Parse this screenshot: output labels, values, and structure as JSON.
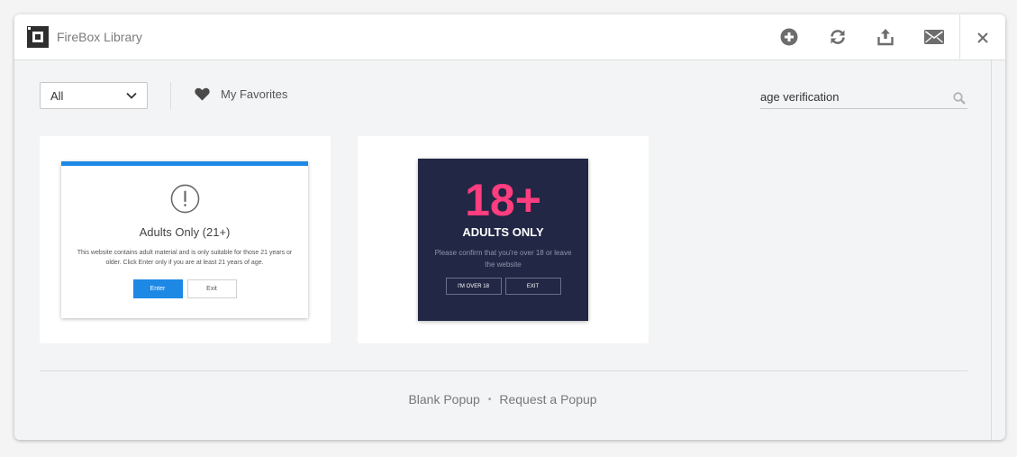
{
  "header": {
    "title": "FireBox Library",
    "actions": [
      "add-icon",
      "refresh-icon",
      "upload-icon",
      "mail-icon"
    ],
    "close": "close-icon"
  },
  "toolbar": {
    "filter_value": "All",
    "favorites_label": "My Favorites",
    "search_value": "age verification"
  },
  "templates": [
    {
      "title": "Adults Only (21+)",
      "body": "This website contains adult material and is only suitable for those 21 years or older. Click Enter only if you are at least 21 years of age.",
      "enter_label": "Enter",
      "exit_label": "Exit",
      "accent": "#1e88e5"
    },
    {
      "big_text": "18+",
      "subtitle": "ADULTS ONLY",
      "body": "Please confirm that you're over 18 or leave the website",
      "over_label": "I'M OVER 18",
      "exit_label": "EXIT",
      "background": "#222745",
      "accent": "#ff3d7f"
    }
  ],
  "footer": {
    "blank_label": "Blank Popup",
    "separator": "•",
    "request_label": "Request a Popup"
  }
}
